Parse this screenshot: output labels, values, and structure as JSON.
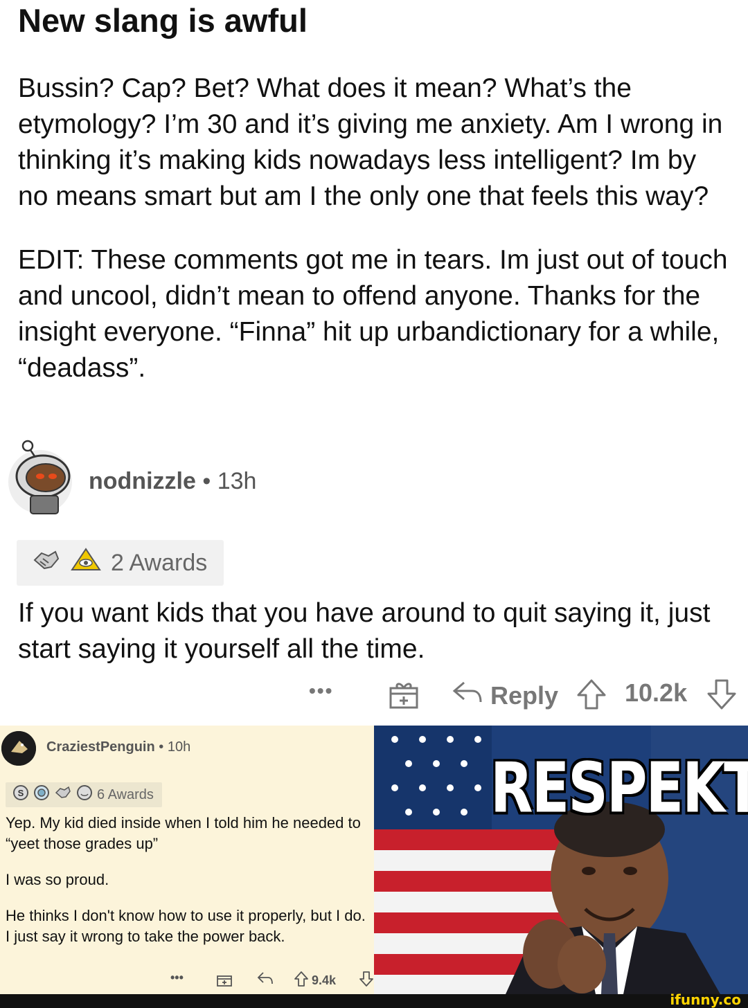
{
  "post": {
    "title": "New slang is awful",
    "body_p1": "Bussin? Cap? Bet? What does it mean? What’s the etymology? I’m 30 and it’s giving me anxiety. Am I wrong in thinking it’s making kids nowadays less intelligent? Im by no means smart but am I the only one that feels this way?",
    "body_p2": "EDIT: These comments got me in tears. Im just out of touch and uncool, didn’t mean to offend anyone. Thanks for the insight everyone. “Finna” hit up urbandictionary for a while, “deadass”."
  },
  "comment1": {
    "username": "nodnizzle",
    "separator": "•",
    "time": "13h",
    "awards_label": "2 Awards",
    "text": "If you want kids that you have around to quit saying it, just start saying it yourself all the time.",
    "actions": {
      "more": "•••",
      "reply": "Reply",
      "score": "10.2k"
    }
  },
  "comment2": {
    "username": "CraziestPenguin",
    "separator": "•",
    "time": "10h",
    "awards_label": "6 Awards",
    "p1": "Yep. My kid died inside when I told him he needed to “yeet those grades up”",
    "p2": "I was so proud.",
    "p3": "He thinks I don't know how to use it properly, but I do. I just say it wrong to take the power back.",
    "actions": {
      "more": "•••",
      "score": "9.4k"
    }
  },
  "meme": {
    "caption": "RESPEKT"
  },
  "watermark": "ifunny.co",
  "icons": {
    "avatar1": "snoo-avatar-icon",
    "award_hands": "handshake-award-icon",
    "award_pyramid": "all-seeing-upvote-award-icon",
    "gift": "gift-icon",
    "reply": "reply-arrow-icon",
    "upvote": "upvote-arrow-icon",
    "downvote": "downvote-arrow-icon"
  },
  "colors": {
    "meta_gray": "#555555",
    "cream_bg": "#fcf4da",
    "award_bg": "#f1f1f1",
    "ifunny_yellow": "#ffd400"
  }
}
